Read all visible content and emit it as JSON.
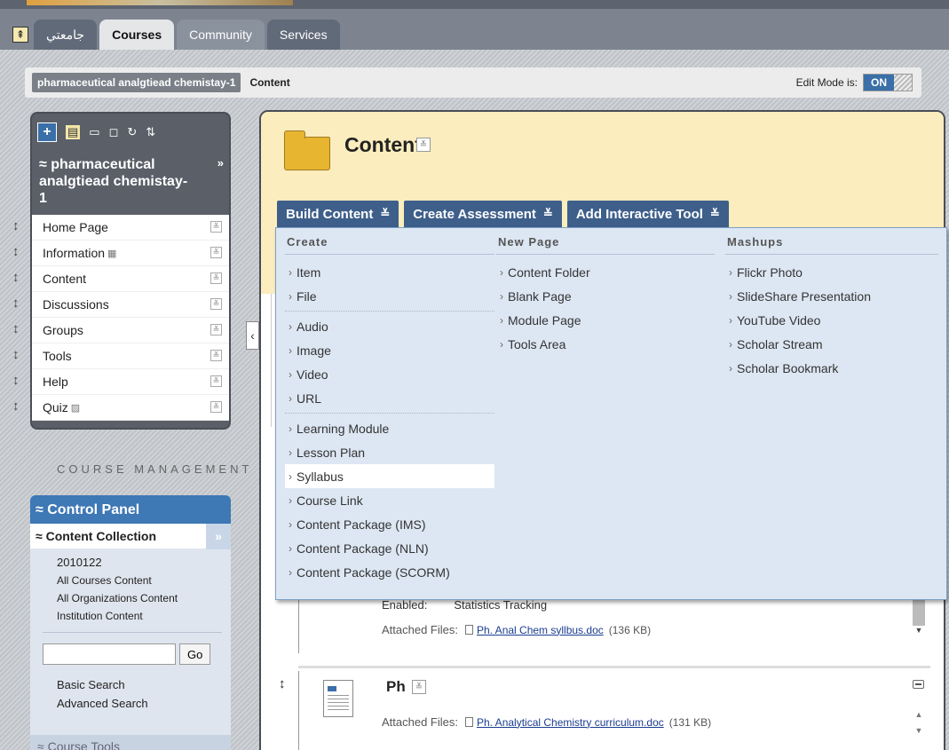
{
  "tabs": [
    {
      "label": "جامعتي",
      "active": false
    },
    {
      "label": "Courses",
      "active": true
    },
    {
      "label": "Community",
      "active": false
    },
    {
      "label": "Services",
      "active": false
    }
  ],
  "breadcrumb": {
    "course": "pharmaceutical analgtiead chemistay-1",
    "current": "Content"
  },
  "edit_mode": {
    "label": "Edit Mode is:",
    "value": "ON"
  },
  "course_menu": {
    "title": "pharmaceutical analgtiead chemistay-1",
    "expand_glyph": "»",
    "items": [
      {
        "label": "Home Page",
        "glyph": ""
      },
      {
        "label": "Information",
        "glyph": "▦"
      },
      {
        "label": "Content",
        "glyph": ""
      },
      {
        "label": "Discussions",
        "glyph": ""
      },
      {
        "label": "Groups",
        "glyph": ""
      },
      {
        "label": "Tools",
        "glyph": ""
      },
      {
        "label": "Help",
        "glyph": ""
      },
      {
        "label": "Quiz",
        "glyph": "▨"
      }
    ]
  },
  "course_management": {
    "heading": "COURSE MANAGEMENT",
    "control_panel": "Control Panel",
    "content_collection": "Content Collection",
    "links": [
      "2010122",
      "All Courses Content",
      "All Organizations Content",
      "Institution Content"
    ],
    "go_label": "Go",
    "search_links": [
      "Basic Search",
      "Advanced Search"
    ],
    "course_tools": "Course Tools"
  },
  "main": {
    "title": "Content",
    "actions": [
      "Build Content",
      "Create Assessment",
      "Add Interactive Tool"
    ]
  },
  "dropdown": {
    "create": {
      "heading": "Create",
      "groups": [
        [
          "Item",
          "File"
        ],
        [
          "Audio",
          "Image",
          "Video",
          "URL"
        ],
        [
          "Learning Module",
          "Lesson Plan",
          "Syllabus",
          "Course Link",
          "Content Package (IMS)",
          "Content Package (NLN)",
          "Content Package (SCORM)"
        ]
      ],
      "highlighted": "Syllabus"
    },
    "new_page": {
      "heading": "New Page",
      "items": [
        "Content Folder",
        "Blank Page",
        "Module Page",
        "Tools Area"
      ]
    },
    "mashups": {
      "heading": "Mashups",
      "items": [
        "Flickr Photo",
        "SlideShare Presentation",
        "YouTube Video",
        "Scholar Stream",
        "Scholar Bookmark"
      ]
    }
  },
  "items": {
    "item1": {
      "enabled_label": "Enabled:",
      "enabled_value": "Statistics Tracking",
      "files_label": "Attached Files:",
      "file_name": "Ph. Anal Chem syllbus.doc",
      "file_size": "(136 KB)"
    },
    "item2": {
      "title": "Ph",
      "files_label": "Attached Files:",
      "file_name": "Ph. Analytical Chemistry curriculum.doc",
      "file_size": "(131 KB)"
    }
  }
}
